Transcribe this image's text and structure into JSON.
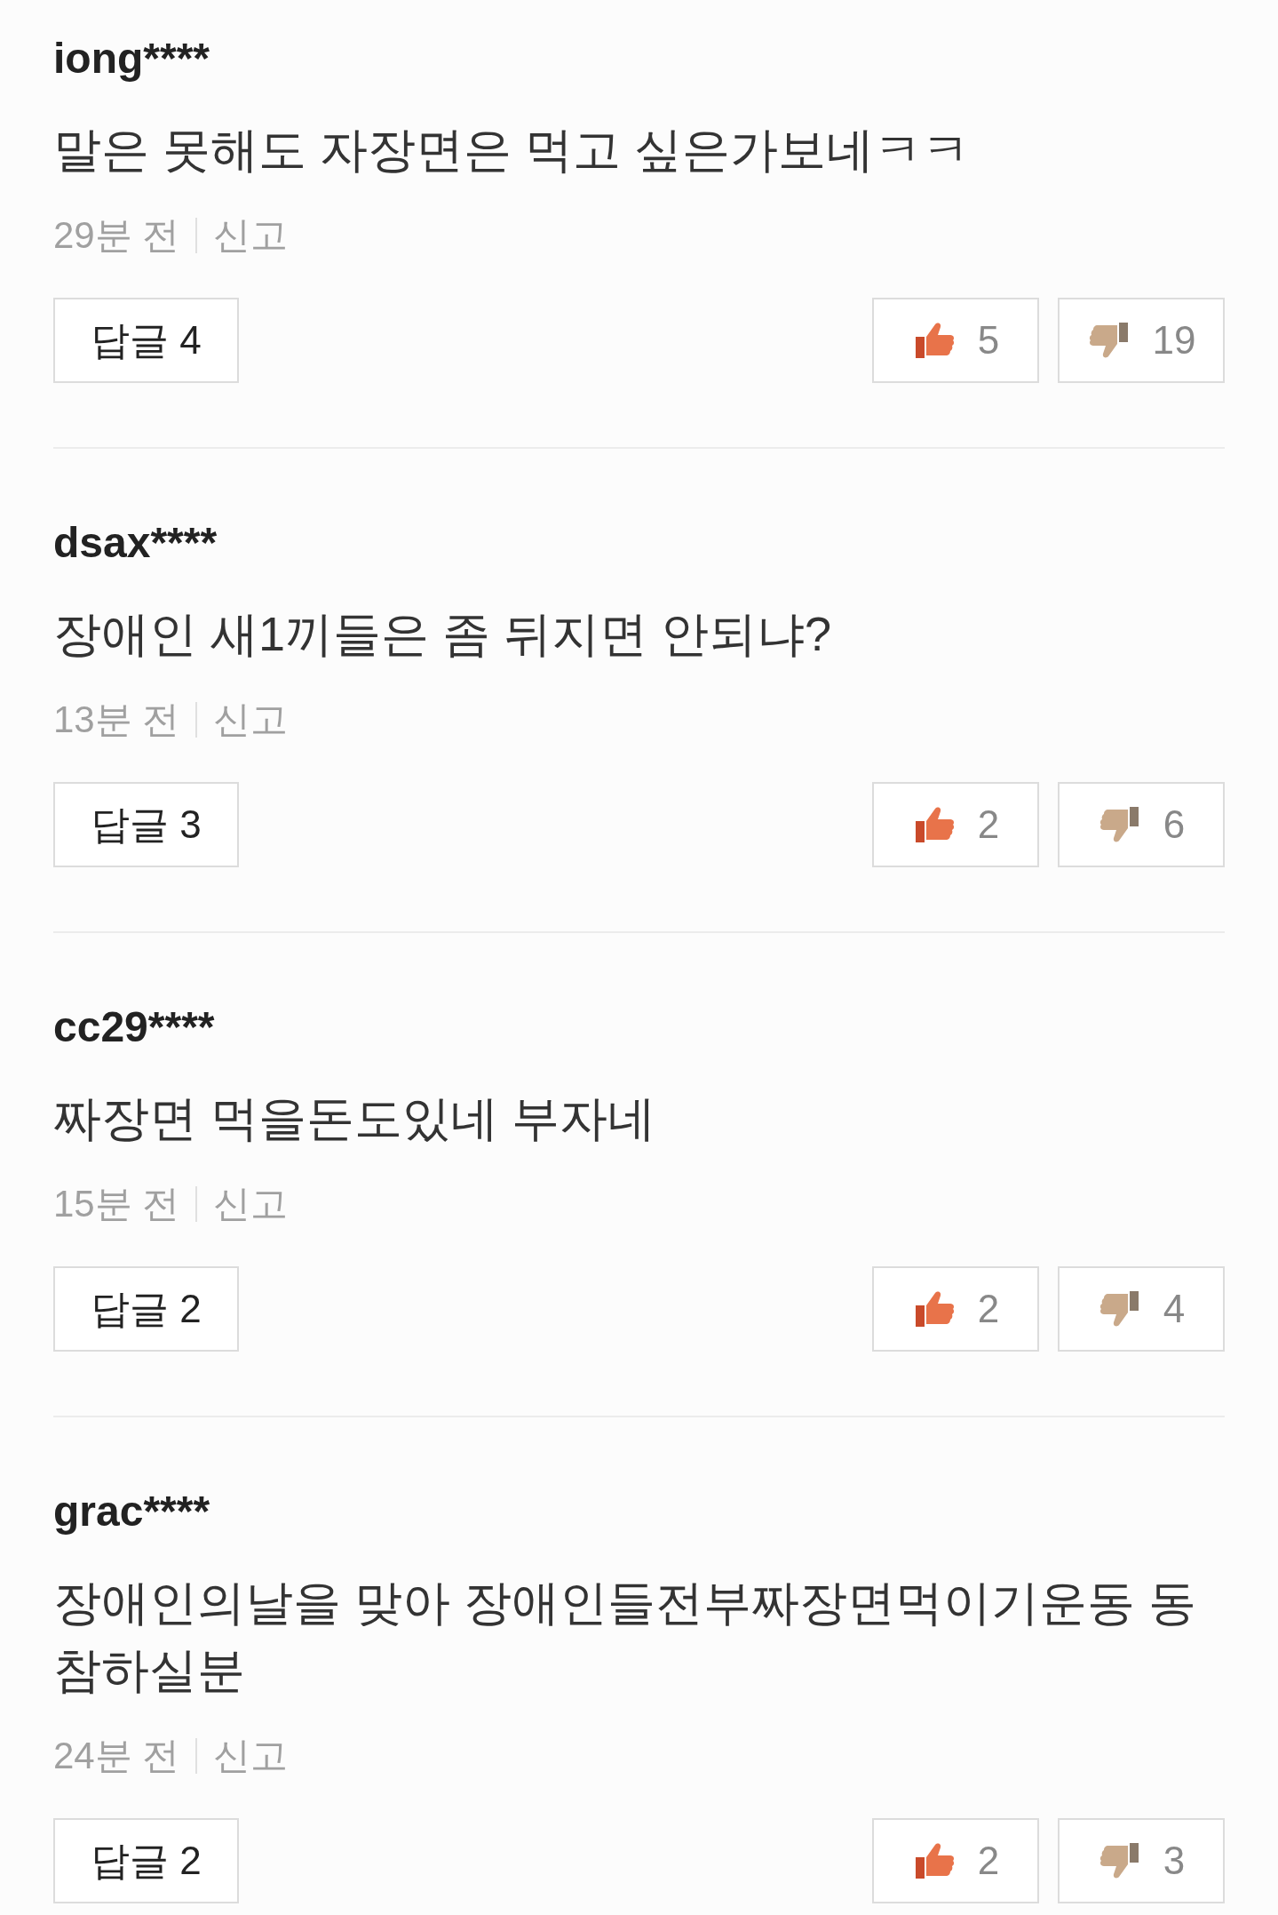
{
  "comments": [
    {
      "username": "iong****",
      "text": "말은 못해도 자장면은 먹고 싶은가보네ㅋㅋ",
      "time": "29분 전",
      "report": "신고",
      "reply_button": "답글 4",
      "likes": "5",
      "dislikes": "19"
    },
    {
      "username": "dsax****",
      "text": "장애인 새1끼들은 좀 뒤지면 안되냐?",
      "time": "13분 전",
      "report": "신고",
      "reply_button": "답글 3",
      "likes": "2",
      "dislikes": "6"
    },
    {
      "username": "cc29****",
      "text": "짜장면 먹을돈도있네 부자네",
      "time": "15분 전",
      "report": "신고",
      "reply_button": "답글 2",
      "likes": "2",
      "dislikes": "4"
    },
    {
      "username": "grac****",
      "text": "장애인의날을 맞아 장애인들전부짜장면먹이기운동 동참하실분",
      "time": "24분 전",
      "report": "신고",
      "reply_button": "답글 2",
      "likes": "2",
      "dislikes": "3"
    }
  ]
}
